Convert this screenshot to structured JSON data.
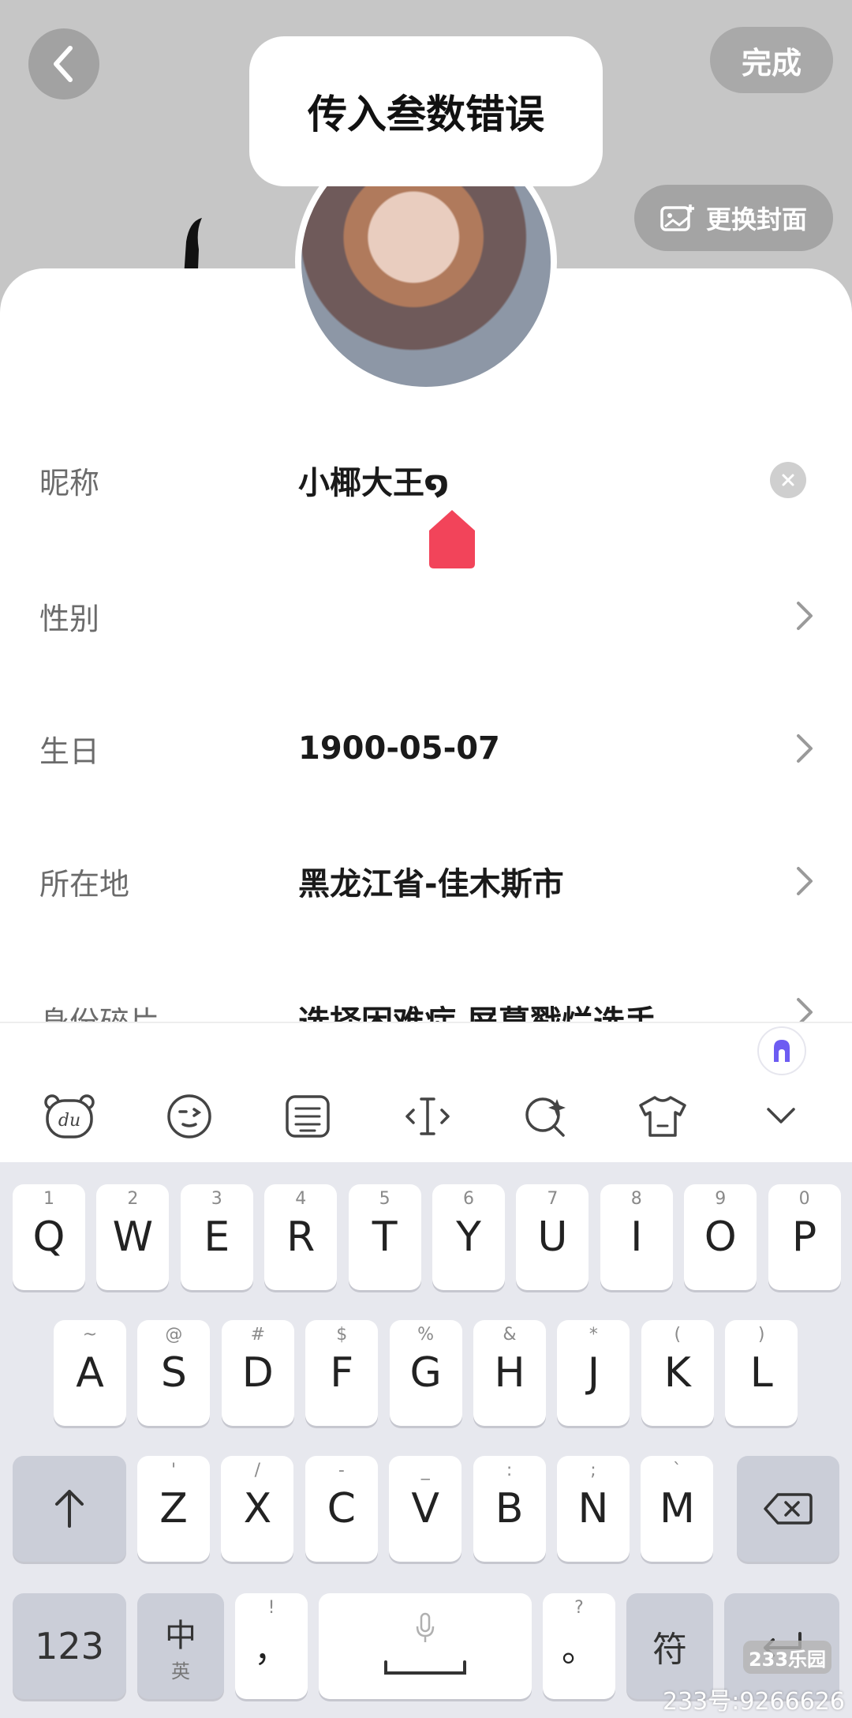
{
  "header": {
    "done_label": "完成",
    "change_cover_label": "更换封面"
  },
  "toast": {
    "text": "传入叁数错误"
  },
  "form": {
    "rows": [
      {
        "label": "昵称",
        "value": "小椰大王໑"
      },
      {
        "label": "性别",
        "value": ""
      },
      {
        "label": "生日",
        "value": "1900-05-07"
      },
      {
        "label": "所在地",
        "value": "黑龙江省-佳木斯市"
      },
      {
        "label": "身份碎片",
        "value": "选择困难症  屏幕戳烂选手"
      }
    ]
  },
  "keyboard": {
    "row1": [
      {
        "main": "Q",
        "sub": "1"
      },
      {
        "main": "W",
        "sub": "2"
      },
      {
        "main": "E",
        "sub": "3"
      },
      {
        "main": "R",
        "sub": "4"
      },
      {
        "main": "T",
        "sub": "5"
      },
      {
        "main": "Y",
        "sub": "6"
      },
      {
        "main": "U",
        "sub": "7"
      },
      {
        "main": "I",
        "sub": "8"
      },
      {
        "main": "O",
        "sub": "9"
      },
      {
        "main": "P",
        "sub": "0"
      }
    ],
    "row2": [
      {
        "main": "A",
        "sub": "~"
      },
      {
        "main": "S",
        "sub": "@"
      },
      {
        "main": "D",
        "sub": "#"
      },
      {
        "main": "F",
        "sub": "$"
      },
      {
        "main": "G",
        "sub": "%"
      },
      {
        "main": "H",
        "sub": "&"
      },
      {
        "main": "J",
        "sub": "*"
      },
      {
        "main": "K",
        "sub": "("
      },
      {
        "main": "L",
        "sub": ")"
      }
    ],
    "row3": [
      {
        "main": "Z",
        "sub": "'"
      },
      {
        "main": "X",
        "sub": "/"
      },
      {
        "main": "C",
        "sub": "-"
      },
      {
        "main": "V",
        "sub": "_"
      },
      {
        "main": "B",
        "sub": ":"
      },
      {
        "main": "N",
        "sub": ";"
      },
      {
        "main": "M",
        "sub": "`"
      }
    ],
    "num_label": "123",
    "lang_main": "中",
    "lang_sub": "英",
    "comma_main": "，",
    "comma_sub": "!",
    "period_main": "。",
    "period_sub": "?",
    "symbol_label": "符"
  },
  "watermark": {
    "badge": "233乐园",
    "text": "233号:9266626"
  },
  "icons": {
    "back": "chevron-left-icon",
    "camera": "image-plus-icon",
    "toolbar": [
      "du-bear-icon",
      "emoji-icon",
      "clipboard-icon",
      "cursor-move-icon",
      "search-sparkle-icon",
      "shirt-icon",
      "chevron-down-icon"
    ]
  },
  "colors": {
    "accent": "#f2445a",
    "cover": "#c6c6c6",
    "keyboard_bg": "#e7e8ee"
  }
}
